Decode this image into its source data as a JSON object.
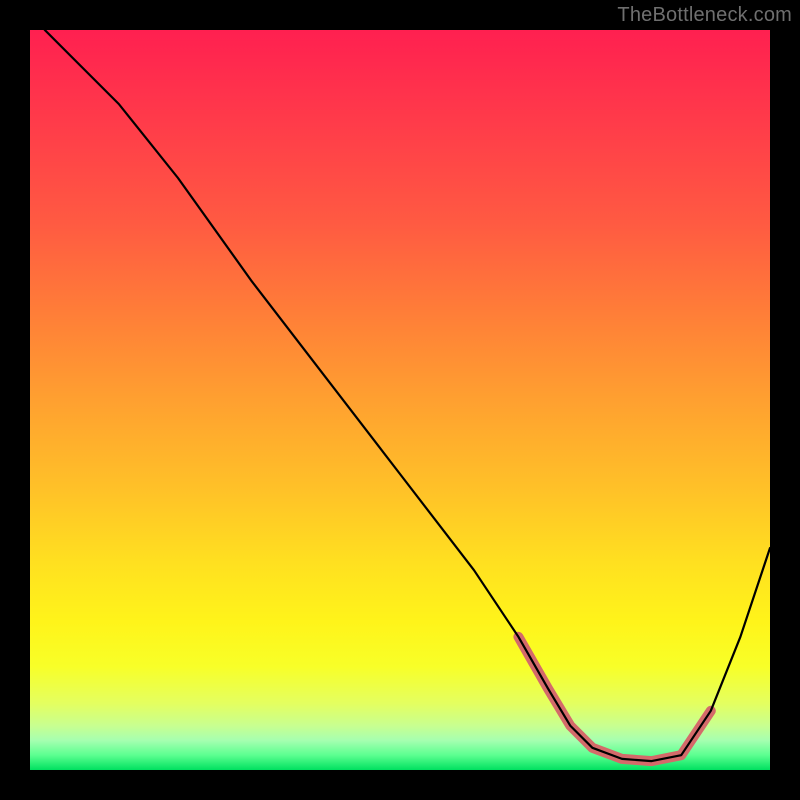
{
  "watermark": "TheBottleneck.com",
  "chart_data": {
    "type": "line",
    "title": "",
    "xlabel": "",
    "ylabel": "",
    "xlim": [
      0,
      1
    ],
    "ylim": [
      0,
      1
    ],
    "series": [
      {
        "name": "main-curve",
        "color": "#000000",
        "x": [
          0.02,
          0.06,
          0.12,
          0.2,
          0.3,
          0.4,
          0.5,
          0.6,
          0.66,
          0.7,
          0.73,
          0.76,
          0.8,
          0.84,
          0.88,
          0.92,
          0.96,
          1.0
        ],
        "values": [
          1.0,
          0.96,
          0.9,
          0.8,
          0.66,
          0.53,
          0.4,
          0.27,
          0.18,
          0.11,
          0.06,
          0.03,
          0.015,
          0.012,
          0.02,
          0.08,
          0.18,
          0.3
        ]
      },
      {
        "name": "bottleneck-band",
        "color": "#d46a6a",
        "x": [
          0.66,
          0.7,
          0.73,
          0.76,
          0.8,
          0.84,
          0.88,
          0.92
        ],
        "values": [
          0.18,
          0.11,
          0.06,
          0.03,
          0.015,
          0.012,
          0.02,
          0.08
        ]
      }
    ],
    "gradient_stops": [
      {
        "pct": 0,
        "color": "#ff2050"
      },
      {
        "pct": 50,
        "color": "#ffa030"
      },
      {
        "pct": 80,
        "color": "#fff41a"
      },
      {
        "pct": 100,
        "color": "#00e060"
      }
    ]
  }
}
